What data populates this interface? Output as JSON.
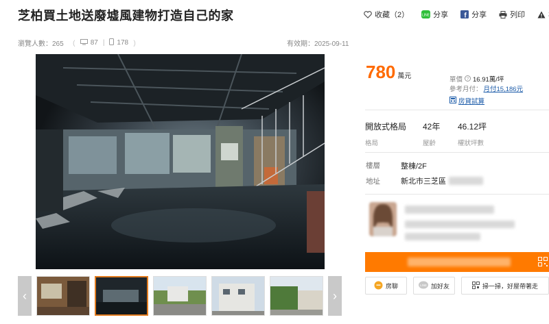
{
  "title": "芝柏買土地送廢墟風建物打造自己的家",
  "actions": {
    "favorite": "收藏（2）",
    "line_share": "分享",
    "fb_share": "分享",
    "print": "列印",
    "report": "檢舉"
  },
  "meta": {
    "views": "瀏覽人數：265",
    "desktop_views": "87",
    "mobile_views": "178",
    "expiry": "有效期：2025-09-11"
  },
  "price": {
    "value": "780",
    "unit": "萬元",
    "unit_price_label": "單價",
    "unit_price": "16.91萬/坪",
    "mortgage_label": "參考月付：",
    "mortgage": "月付15,186元",
    "calc_link": "房貸試算"
  },
  "specs": [
    {
      "value": "開放式格局",
      "label": "格局"
    },
    {
      "value": "42年",
      "label": "屋齡"
    },
    {
      "value": "46.12坪",
      "label": "權狀坪數"
    }
  ],
  "details": {
    "floor_label": "樓層",
    "floor_value": "整棟/2F",
    "address_label": "地址",
    "address_value": "新北市三芝區"
  },
  "buttons": {
    "chat": "房聊",
    "add_friend": "加好友",
    "scan": "掃一掃，好屋帶著走"
  },
  "gallery": {
    "prev": "‹",
    "next": "›"
  },
  "colors": {
    "accent": "#ff6a00",
    "cta": "#ff7a00",
    "link": "#1a5aa8"
  }
}
